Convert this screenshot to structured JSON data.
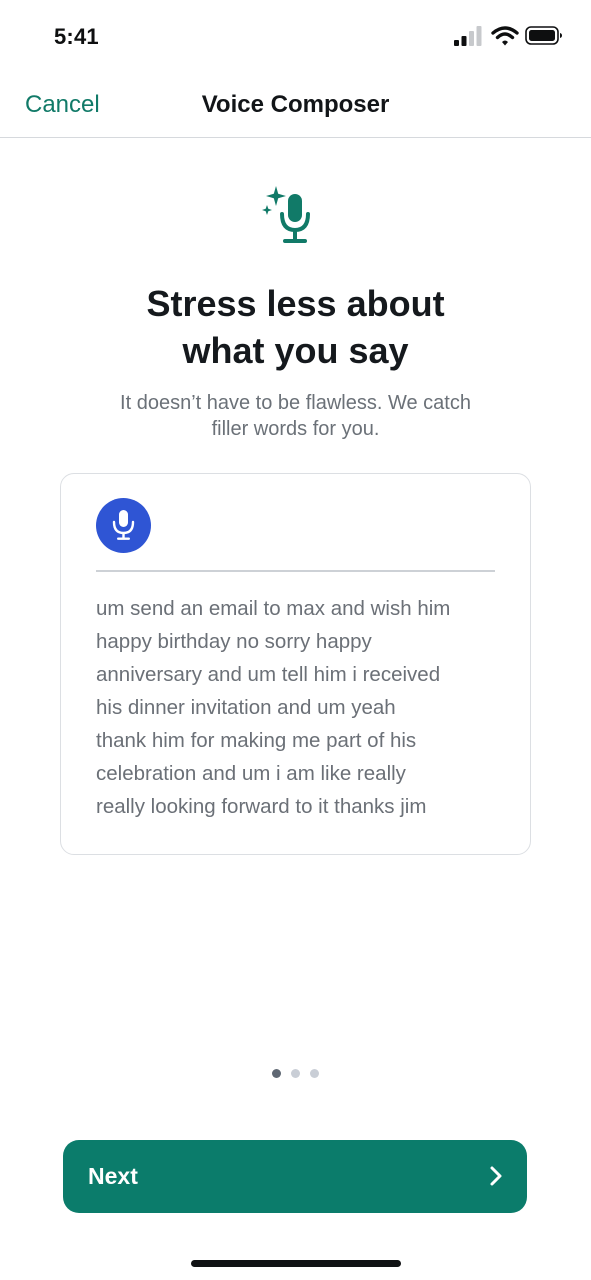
{
  "status_bar": {
    "time": "5:41",
    "icons": [
      "cellular-signal-icon",
      "wifi-icon",
      "battery-icon"
    ]
  },
  "nav": {
    "cancel_label": "Cancel",
    "title": "Voice Composer"
  },
  "hero": {
    "icon": "sparkle-microphone-icon",
    "headline_line1": "Stress less about",
    "headline_line2": "what you say",
    "subhead_line1": "It doesn’t have to be flawless. We catch",
    "subhead_line2": "filler words for you."
  },
  "card": {
    "mic_icon": "microphone-icon",
    "transcript_lines": [
      "um send an email to max and wish him",
      "happy birthday no sorry happy",
      "anniversary and um tell him i received",
      "his dinner invitation and um yeah",
      "thank him for making me part of his",
      "celebration and um i am like really",
      "really looking forward to it thanks jim"
    ]
  },
  "pagination": {
    "total_pages": 3,
    "current_page": 1
  },
  "footer": {
    "next_label": "Next",
    "next_icon": "chevron-right-icon"
  },
  "colors": {
    "accent": "#0b7c6b",
    "link": "#117a68",
    "mic_blue": "#2f55d4"
  }
}
